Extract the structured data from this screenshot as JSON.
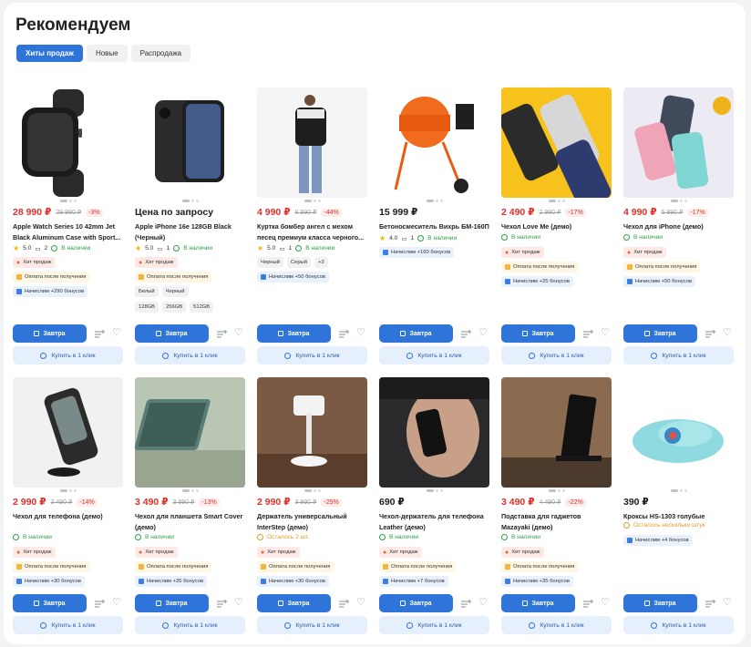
{
  "section_title": "Рекомендуем",
  "tabs": [
    {
      "label": "Хиты продаж",
      "active": true
    },
    {
      "label": "Новые",
      "active": false
    },
    {
      "label": "Распродажа",
      "active": false
    }
  ],
  "buttons": {
    "buy_label": "Завтра",
    "one_click_label": "Купить в 1 клик"
  },
  "badges": {
    "hit": "Хит продаж",
    "pay_after": "Оплата после получения",
    "in_stock": "В наличии"
  },
  "products": [
    {
      "price": "28 990 ₽",
      "old_price": "29 990 ₽",
      "discount": "-3%",
      "name": "Apple Watch Series 10 42mm Jet Black Aluminum Case with Sport...",
      "rating": "5.0",
      "reviews": "2",
      "stock": "В наличии",
      "hit": true,
      "pay": true,
      "bonus": "Начислим +290 бонусов",
      "options": []
    },
    {
      "price": "Цена по запросу",
      "name": "Apple iPhone 16e 128GB Black (Черный)",
      "rating": "5.0",
      "reviews": "1",
      "stock": "В наличии",
      "hit": true,
      "pay": true,
      "options": [
        "Белый",
        "Черный"
      ],
      "options2": [
        "128GB",
        "256GB",
        "512GB"
      ]
    },
    {
      "price": "4 990 ₽",
      "old_price": "8 990 ₽",
      "discount": "-44%",
      "name": "Куртка бомбер ангел с мехом песец премиум класса черного...",
      "rating": "5.0",
      "reviews": "1",
      "stock": "В наличии",
      "options": [
        "Черный",
        "Серый",
        "+3"
      ],
      "bonus": "Начислим +50 бонусов"
    },
    {
      "price": "15 999 ₽",
      "name": "Бетоносмеситель Вихрь БМ-160П",
      "rating": "4.0",
      "reviews": "1",
      "stock": "В наличии",
      "bonus": "Начислим +160 бонусов"
    },
    {
      "price": "2 490 ₽",
      "old_price": "2 990 ₽",
      "discount": "-17%",
      "name": "Чехол Love Me (демо)",
      "stock": "В наличии",
      "hit": true,
      "pay": true,
      "bonus": "Начислим +25 бонусов"
    },
    {
      "price": "4 990 ₽",
      "old_price": "5 990 ₽",
      "discount": "-17%",
      "name": "Чехол для iPhone (демо)",
      "stock": "В наличии",
      "hit": true,
      "pay": true,
      "bonus": "Начислим +50 бонусов"
    },
    {
      "price": "2 990 ₽",
      "old_price": "3 490 ₽",
      "discount": "-14%",
      "name": "Чехол для телефона (демо)",
      "stock": "В наличии",
      "hit": true,
      "pay": true,
      "bonus": "Начислим +30 бонусов"
    },
    {
      "price": "3 490 ₽",
      "old_price": "3 990 ₽",
      "discount": "-13%",
      "name": "Чехол для планшета Smart Cover (демо)",
      "stock": "В наличии",
      "hit": true,
      "pay": true,
      "bonus": "Начислим +35 бонусов"
    },
    {
      "price": "2 990 ₽",
      "old_price": "3 990 ₽",
      "discount": "-25%",
      "name": "Держатель универсальный InterStep (демо)",
      "stock": "Осталось 2 шт.",
      "stock_low": true,
      "hit": true,
      "pay": true,
      "bonus": "Начислим +30 бонусов"
    },
    {
      "price": "690 ₽",
      "name": "Чехол-держатель для телефона Leather (демо)",
      "stock": "В наличии",
      "hit": true,
      "pay": true,
      "bonus": "Начислим +7 бонусов"
    },
    {
      "price": "3 490 ₽",
      "old_price": "4 490 ₽",
      "discount": "-22%",
      "name": "Подставка для гаджетов Mazayaki (демо)",
      "stock": "В наличии",
      "hit": true,
      "pay": true,
      "bonus": "Начислим +35 бонусов"
    },
    {
      "price": "390 ₽",
      "name": "Кроксы HS-1303 голубые",
      "stock": "Осталось несколько штук",
      "stock_low": true,
      "bonus": "Начислим +4 бонусов"
    }
  ]
}
